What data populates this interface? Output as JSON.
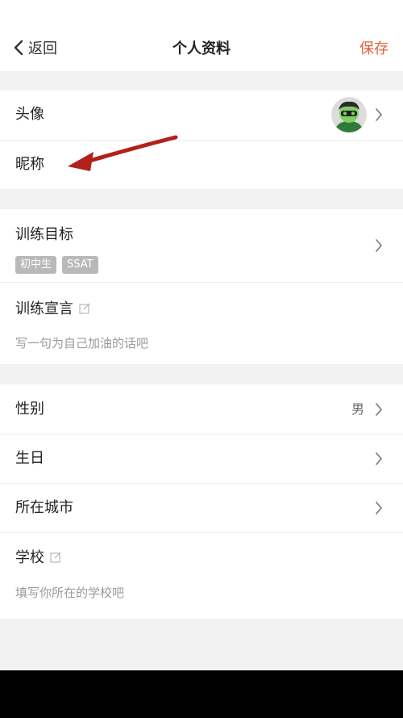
{
  "nav": {
    "back_label": "返回",
    "title": "个人资料",
    "save_label": "保存"
  },
  "profile": {
    "avatar_label": "头像",
    "nickname_label": "昵称"
  },
  "training": {
    "goal_label": "训练目标",
    "goal_tags": [
      "初中生",
      "SSAT"
    ],
    "motto_label": "训练宣言",
    "motto_placeholder": "写一句为自己加油的话吧"
  },
  "info": {
    "gender_label": "性别",
    "gender_value": "男",
    "birthday_label": "生日",
    "city_label": "所在城市",
    "school_label": "学校",
    "school_placeholder": "填写你所在的学校吧"
  },
  "colors": {
    "accent": "#e0623d",
    "annotation_arrow": "#b3201c",
    "tag_bg": "#b9b9b9"
  }
}
